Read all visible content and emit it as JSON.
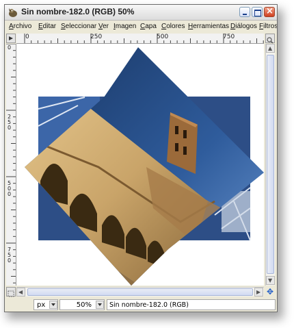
{
  "window": {
    "title": "Sin nombre-182.0 (RGB) 50%"
  },
  "menu": [
    "Archivo",
    "Editar",
    "Seleccionar",
    "Ver",
    "Imagen",
    "Capa",
    "Colores",
    "Herramientas",
    "Diálogos",
    "Filtros"
  ],
  "rulers": {
    "horizontal_labels": [
      "0",
      "250",
      "500",
      "750"
    ],
    "vertical_labels": [
      "0",
      "250",
      "500",
      "750"
    ]
  },
  "statusbar": {
    "unit": "px",
    "zoom": "50%",
    "image_info": "Sin nombre-182.0 (RGB)"
  },
  "icons": {
    "app": "gimp-wilber-icon",
    "minimize": "minimize-icon",
    "maximize": "maximize-icon",
    "close": "close-icon",
    "navigate": "navigate-cross-icon",
    "quick_mask": "quick-mask-icon",
    "zoom_nav": "zoom-icon"
  },
  "colors": {
    "sky_dark": "#17335f",
    "sky_light": "#4b7cc0",
    "stone": "#c9a469",
    "stone_shadow": "#3a2a12"
  }
}
